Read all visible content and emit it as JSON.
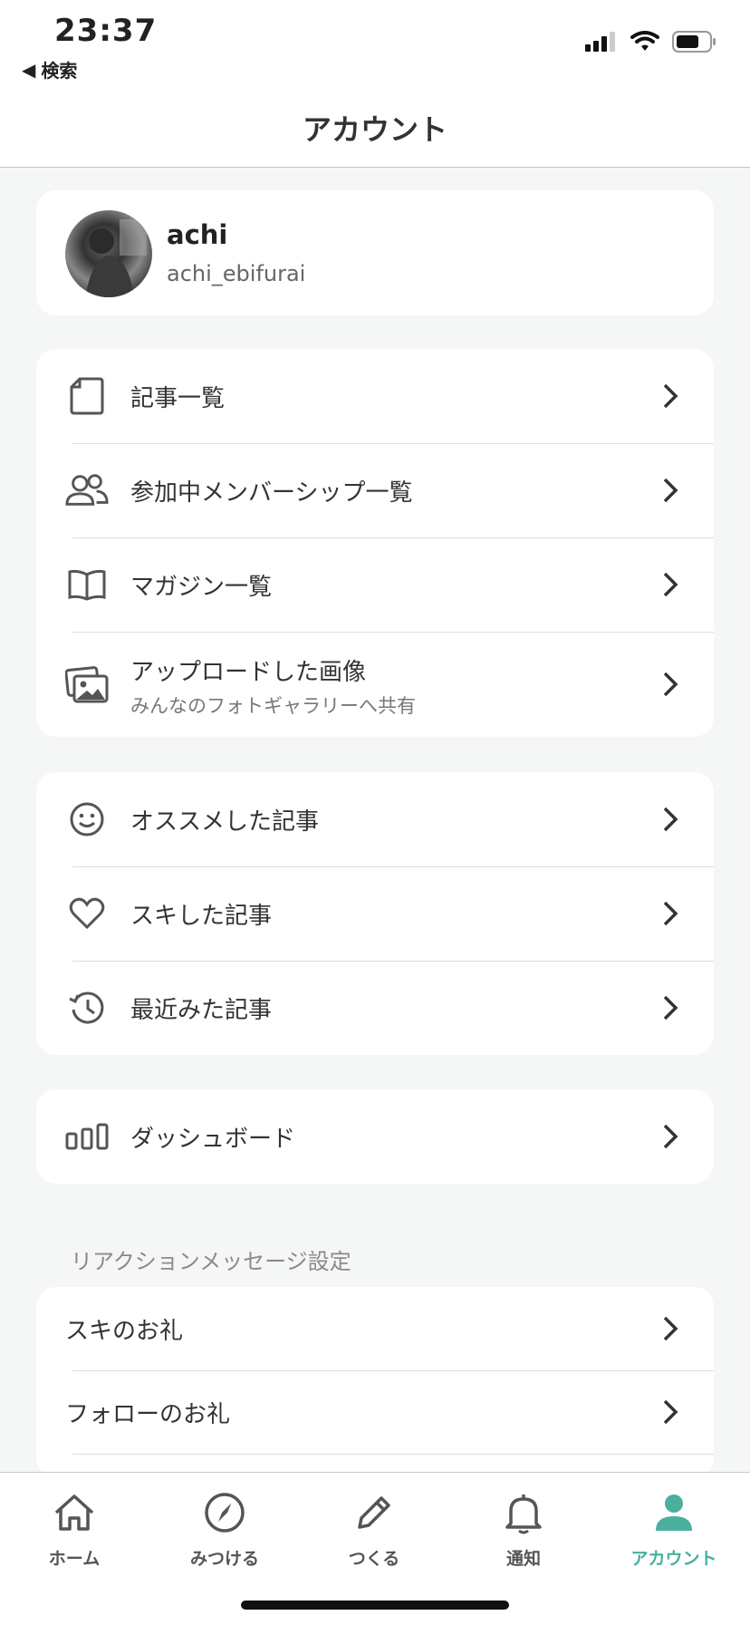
{
  "status_bar": {
    "time": "23:37",
    "back_label": "検索"
  },
  "nav": {
    "title": "アカウント"
  },
  "profile": {
    "name": "achi",
    "handle": "achi_ebifurai"
  },
  "group1": [
    {
      "label": "記事一覧",
      "icon": "document-icon"
    },
    {
      "label": "参加中メンバーシップ一覧",
      "icon": "members-icon"
    },
    {
      "label": "マガジン一覧",
      "icon": "book-icon"
    },
    {
      "label": "アップロードした画像",
      "sub": "みんなのフォトギャラリーへ共有",
      "icon": "images-icon"
    }
  ],
  "group2": [
    {
      "label": "オススメした記事",
      "icon": "smile-icon"
    },
    {
      "label": "スキした記事",
      "icon": "heart-icon"
    },
    {
      "label": "最近みた記事",
      "icon": "history-icon"
    }
  ],
  "group3": [
    {
      "label": "ダッシュボード",
      "icon": "dashboard-icon"
    }
  ],
  "reaction_section": {
    "title": "リアクションメッセージ設定",
    "items": [
      {
        "label": "スキのお礼"
      },
      {
        "label": "フォローのお礼"
      }
    ]
  },
  "tabs": [
    {
      "label": "ホーム",
      "icon": "home-icon"
    },
    {
      "label": "みつける",
      "icon": "compass-icon"
    },
    {
      "label": "つくる",
      "icon": "pencil-icon"
    },
    {
      "label": "通知",
      "icon": "bell-icon"
    },
    {
      "label": "アカウント",
      "icon": "person-icon",
      "active": true
    }
  ],
  "colors": {
    "accent": "#4aaf9c",
    "background": "#f5f7f6",
    "icon_gray": "#555555"
  }
}
